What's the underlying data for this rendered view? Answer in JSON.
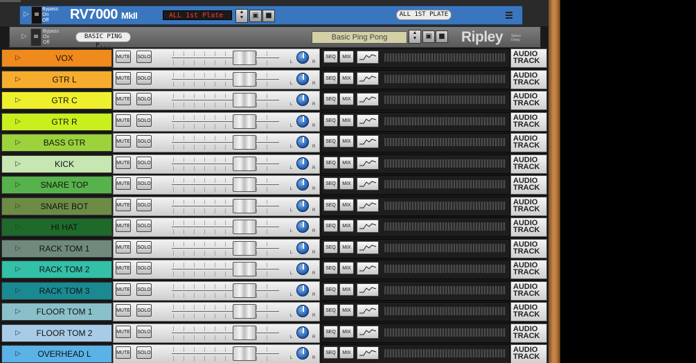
{
  "rv7000": {
    "bypass_labels": [
      "Bypass",
      "On",
      "Off"
    ],
    "title": "RV7000",
    "subtitle": "MkII",
    "program_display": "ALL 1st Plate",
    "patch_tape": "ALL 1ST PLATE",
    "color": "#3a76bd"
  },
  "ripley": {
    "bypass_labels": [
      "Bypass",
      "On",
      "Off"
    ],
    "patch_tape": "BASIC PING P...",
    "preset_display": "Basic Ping Pong",
    "logo": "Ripley",
    "logo_sub": "Space Delay"
  },
  "labels": {
    "mute": "MUTE",
    "solo": "SOLO",
    "seq": "SEQ",
    "mix": "MIX",
    "pan_left": "L",
    "pan_right": "R",
    "track_type_line1": "AUDIO",
    "track_type_line2": "TRACK"
  },
  "channels": [
    {
      "name": "VOX",
      "color": "#f08a1c"
    },
    {
      "name": "GTR L",
      "color": "#f6ac2c"
    },
    {
      "name": "GTR C",
      "color": "#eef02e"
    },
    {
      "name": "GTR R",
      "color": "#c8f01e"
    },
    {
      "name": "BASS GTR",
      "color": "#9cd23c"
    },
    {
      "name": "KICK",
      "color": "#c6e6b2"
    },
    {
      "name": "SNARE TOP",
      "color": "#56b24a"
    },
    {
      "name": "SNARE BOT",
      "color": "#6c8c46"
    },
    {
      "name": "HI HAT",
      "color": "#1e6a2a"
    },
    {
      "name": "RACK TOM 1",
      "color": "#6f8a7c"
    },
    {
      "name": "RACK TOM 2",
      "color": "#32c0a8"
    },
    {
      "name": "RACK TOM 3",
      "color": "#1a8a92"
    },
    {
      "name": "FLOOR TOM 1",
      "color": "#8ac0ca"
    },
    {
      "name": "FLOOR TOM 2",
      "color": "#a8cce8"
    },
    {
      "name": "OVERHEAD L",
      "color": "#5ab2e6"
    }
  ]
}
